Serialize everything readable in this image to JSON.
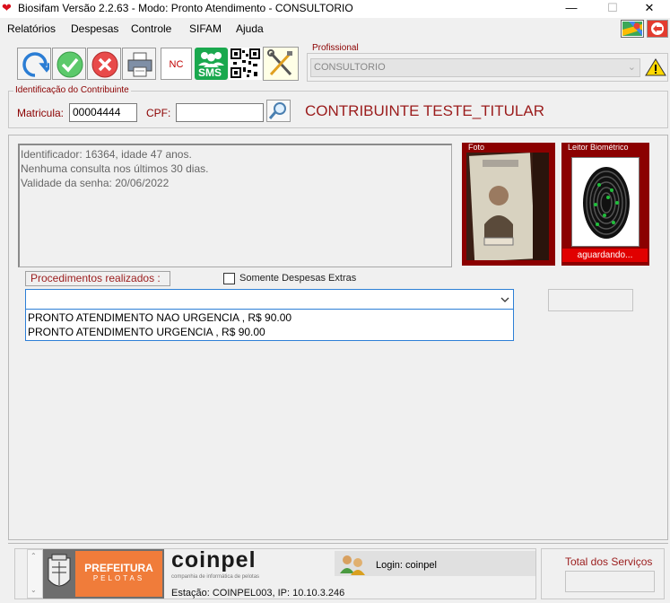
{
  "window": {
    "title": "Biosifam Versão 2.2.63 - Modo: Pronto Atendimento - CONSULTORIO",
    "minimize": "—",
    "maximize": "☐",
    "close": "✕"
  },
  "menu": {
    "items": [
      "Relatórios",
      "Despesas",
      "Controle",
      "SIFAM",
      "Ajuda"
    ]
  },
  "toolbar": {
    "nc_label": "NC",
    "sms_label": "SMS"
  },
  "profissional": {
    "group_label": "Profissional",
    "selected": "CONSULTORIO"
  },
  "identificacao": {
    "group_label": "Identificação do Contribuinte",
    "matricula_label": "Matricula:",
    "matricula_value": "00004444",
    "cpf_label": "CPF:",
    "cpf_value": "",
    "contribuinte_name": "CONTRIBUINTE TESTE_TITULAR"
  },
  "info": {
    "lines": [
      "Identificador: 16364, idade 47 anos.",
      "Nenhuma consulta nos últimos 30 dias.",
      "Validade da senha: 20/06/2022"
    ]
  },
  "foto": {
    "label": "Foto"
  },
  "leitor": {
    "label": "Leitor Biométrico",
    "status": "aguardando..."
  },
  "procedimentos": {
    "label": "Procedimentos realizados :",
    "extras_label": "Somente Despesas Extras",
    "selected": "",
    "options": [
      "PRONTO ATENDIMENTO NAO URGENCIA , R$ 90.00",
      "PRONTO ATENDIMENTO URGENCIA , R$ 90.00"
    ]
  },
  "footer": {
    "prefeitura_line1": "PREFEITURA",
    "prefeitura_line2": "PELOTAS",
    "coinpel_logo": "coinpel",
    "coinpel_sub": "companhia de informática de pelotas",
    "station": "Estação: COINPEL003, IP: 10.10.3.246",
    "login": "Login: coinpel",
    "total_label": "Total dos Serviços",
    "total_value": ""
  },
  "colors": {
    "accent_dark_red": "#8b0000",
    "name_red": "#9b1c1c",
    "combo_blue": "#2d7fd6",
    "prefeitura_orange": "#f07c3a",
    "status_red": "#e10000"
  }
}
